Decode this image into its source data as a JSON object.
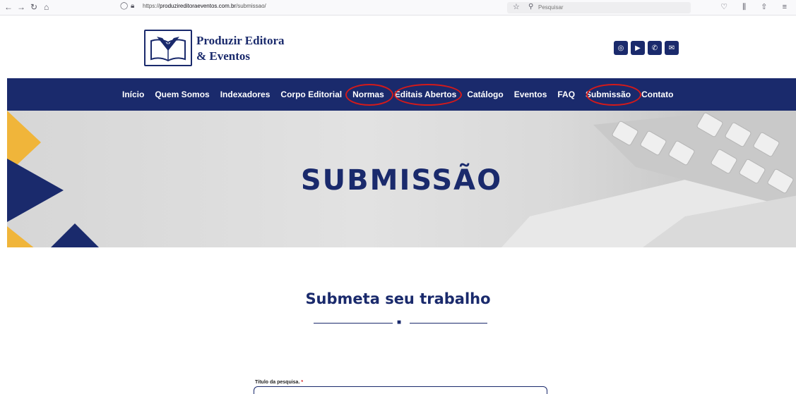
{
  "browser": {
    "url_prefix": "https://",
    "url_domain": "produzireditoraeventos.com.br",
    "url_path": "/submissao/",
    "search_placeholder": "Pesquisar"
  },
  "header": {
    "logo_line1": "Produzir Editora",
    "logo_line2": "& Eventos",
    "socials": [
      "instagram-icon",
      "youtube-icon",
      "whatsapp-icon",
      "email-icon"
    ]
  },
  "nav": {
    "items": [
      "Início",
      "Quem Somos",
      "Indexadores",
      "Corpo Editorial",
      "Normas",
      "Editais Abertos",
      "Catálogo",
      "Eventos",
      "FAQ",
      "Submissão",
      "Contato"
    ],
    "highlighted": [
      "Normas",
      "Editais Abertos",
      "Submissão"
    ],
    "highlight_color": "#d41a1a"
  },
  "hero": {
    "title": "SUBMISSÃO"
  },
  "main": {
    "section_title": "Submeta seu trabalho",
    "field_label": "Título da pesquisa.",
    "required_mark": "*"
  },
  "colors": {
    "brand_navy": "#1a2a6c",
    "accent_yellow": "#f0b53a"
  }
}
